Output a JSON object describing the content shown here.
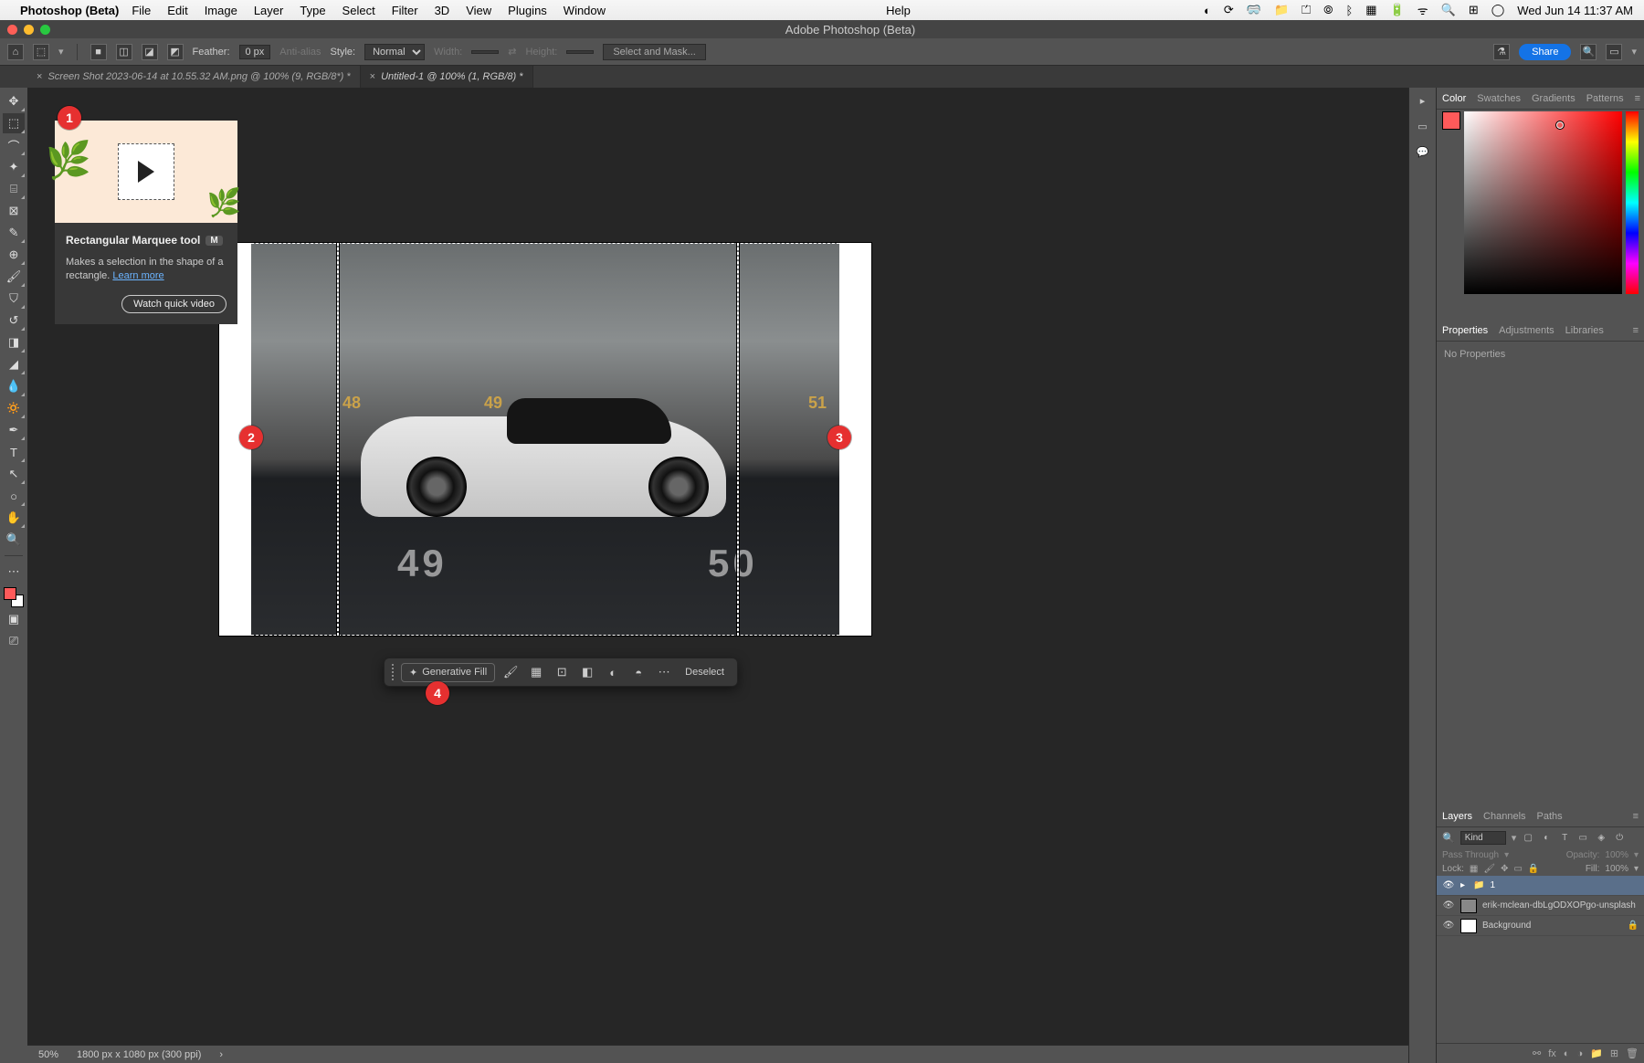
{
  "menubar": {
    "app_name": "Photoshop (Beta)",
    "items": [
      "File",
      "Edit",
      "Image",
      "Layer",
      "Type",
      "Select",
      "Filter",
      "3D",
      "View",
      "Plugins",
      "Window"
    ],
    "help": "Help",
    "clock": "Wed Jun 14  11:37 AM"
  },
  "window_title": "Adobe Photoshop (Beta)",
  "options": {
    "feather_label": "Feather:",
    "feather_value": "0 px",
    "antialias_label": "Anti-alias",
    "style_label": "Style:",
    "style_value": "Normal",
    "width_label": "Width:",
    "height_label": "Height:",
    "mask_button": "Select and Mask...",
    "share": "Share"
  },
  "tabs": [
    {
      "label": "Screen Shot 2023-06-14 at 10.55.32 AM.png @ 100% (9, RGB/8*) *",
      "active": false
    },
    {
      "label": "Untitled-1 @ 100% (1, RGB/8) *",
      "active": true
    }
  ],
  "tooltip": {
    "title": "Rectangular Marquee tool",
    "shortcut": "M",
    "desc_prefix": "Makes a selection in the shape of a rectangle. ",
    "learn_more": "Learn more",
    "button": "Watch quick video"
  },
  "taskbar": {
    "generative": "Generative Fill",
    "deselect": "Deselect"
  },
  "status": {
    "zoom": "50%",
    "dims": "1800 px x 1080 px (300 ppi)"
  },
  "panels": {
    "color_tabs": [
      "Color",
      "Swatches",
      "Gradients",
      "Patterns"
    ],
    "props_tabs": [
      "Properties",
      "Adjustments",
      "Libraries"
    ],
    "no_props": "No Properties",
    "layers_tabs": [
      "Layers",
      "Channels",
      "Paths"
    ],
    "layer_search_placeholder": "Kind",
    "blend_mode": "Pass Through",
    "opacity_label": "Opacity:",
    "opacity_value": "100%",
    "lock_label": "Lock:",
    "fill_label": "Fill:",
    "fill_value": "100%",
    "layers": [
      {
        "name": "1",
        "selected": true,
        "group": true
      },
      {
        "name": "erik-mclean-dbLgODXOPgo-unsplash",
        "selected": false,
        "group": false
      },
      {
        "name": "Background",
        "selected": false,
        "group": false,
        "locked": true
      }
    ]
  },
  "callouts": [
    "1",
    "2",
    "3",
    "4"
  ],
  "wall_numbers": {
    "n48": "48",
    "n49": "49",
    "n51": "51"
  },
  "floor_numbers": {
    "n49": "49",
    "n50": "50"
  }
}
